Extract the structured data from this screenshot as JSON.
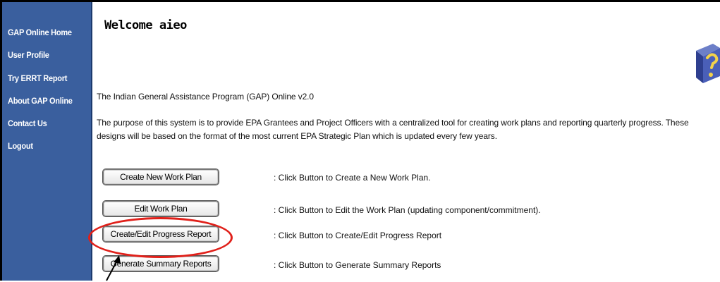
{
  "sidebar": {
    "items": [
      {
        "label": "GAP Online Home"
      },
      {
        "label": "User Profile"
      },
      {
        "label": "Try ERRT Report"
      },
      {
        "label": "About GAP Online"
      },
      {
        "label": "Contact Us"
      },
      {
        "label": "Logout"
      }
    ]
  },
  "main": {
    "welcome": "Welcome aieo",
    "subtitle": "The Indian General Assistance Program (GAP) Online v2.0",
    "purpose": "The purpose of this system is to provide EPA Grantees and Project Officers with a centralized tool for creating work plans and reporting quarterly progress. These designs will be based on the format of the most current EPA Strategic Plan which is updated every few years.",
    "actions": [
      {
        "button": "Create New Work Plan",
        "description": ": Click Button to Create a New Work Plan."
      },
      {
        "button": "Edit Work Plan",
        "description": ": Click Button to Edit the Work Plan (updating component/commitment)."
      },
      {
        "button": "Create/Edit Progress Report",
        "description": ": Click Button to Create/Edit Progress Report"
      },
      {
        "button": "Generate Summary Reports",
        "description": ": Click Button to Generate Summary Reports"
      }
    ]
  },
  "icons": {
    "help": "help-book-icon"
  },
  "colors": {
    "sidebar": "#3a5f9e",
    "highlight": "#e0201a"
  }
}
